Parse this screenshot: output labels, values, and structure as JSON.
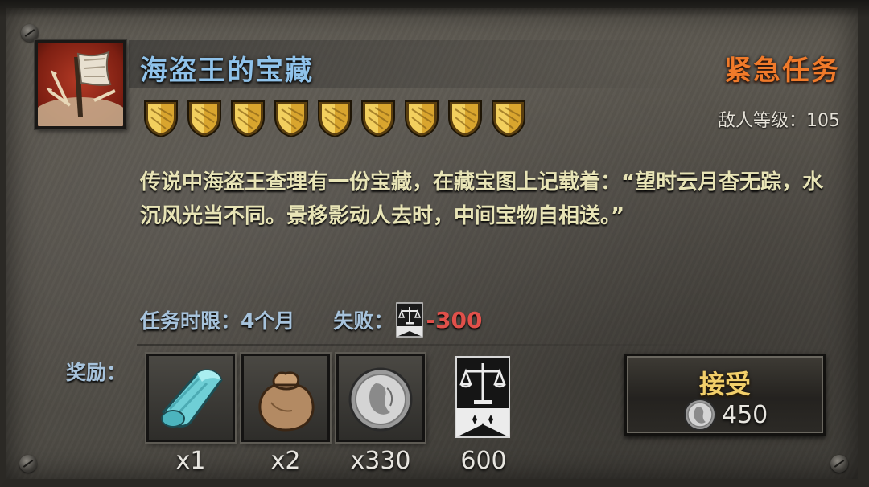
{
  "quest": {
    "title": "海盗王的宝藏",
    "type_label": "紧急任务",
    "enemy_level_label": "敌人等级：",
    "enemy_level_value": "105",
    "difficulty_shields": 9,
    "description": "传说中海盗王查理有一份宝藏，在藏宝图上记载着：“望时云月杳无踪，水沉风光当不同。景移影动人去时，中间宝物自相送。”",
    "time_limit_label": "任务时限：",
    "time_limit_value": "4个月",
    "failure_label": "失败：",
    "failure_penalty": "-300",
    "failure_icon": "justice-scale-icon"
  },
  "rewards": {
    "label": "奖励：",
    "items": [
      {
        "name": "cloth",
        "icon": "cloth-roll-icon",
        "count": "x1"
      },
      {
        "name": "pouch",
        "icon": "sack-icon",
        "count": "x2"
      },
      {
        "name": "silver-coin",
        "icon": "silver-coin-icon",
        "count": "x330"
      },
      {
        "name": "justice",
        "icon": "justice-banner-icon",
        "count": "600"
      }
    ]
  },
  "accept_button": {
    "label": "接受",
    "cost": "450",
    "cost_icon": "silver-coin-icon"
  },
  "colors": {
    "title": "#8fc2ea",
    "urgent": "#f07a2a",
    "description": "#e8e4b6",
    "penalty": "#e0504a",
    "accept": "#f2cf6a",
    "shield_gold": "#d9a52e"
  }
}
